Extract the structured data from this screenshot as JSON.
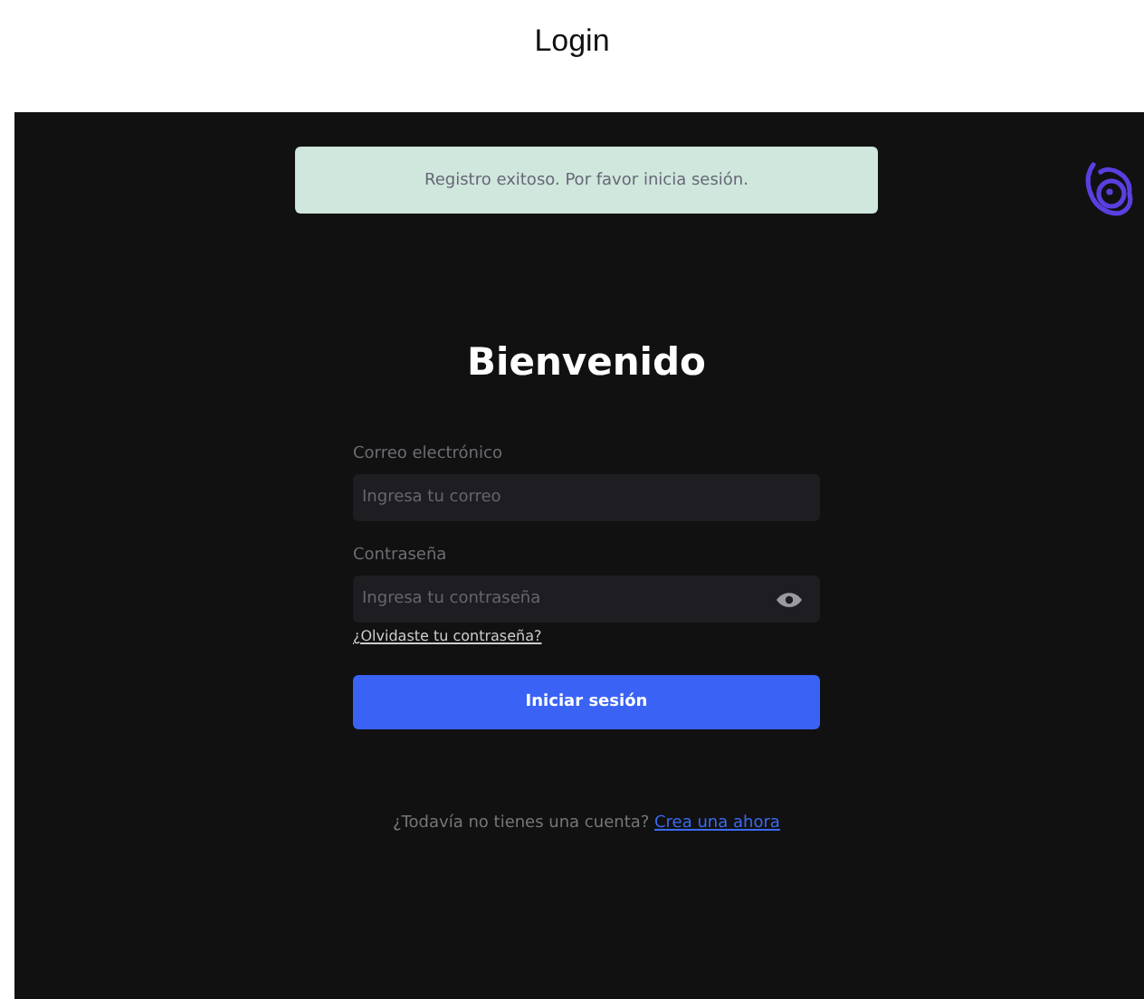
{
  "page_title": "Login",
  "alert": {
    "message": "Registro exitoso. Por favor inicia sesión."
  },
  "heading": "Bienvenido",
  "fields": [
    {
      "label": "Correo electrónico",
      "placeholder": "Ingresa tu correo",
      "kind": "text"
    },
    {
      "label": "Contraseña",
      "placeholder": "Ingresa tu contraseña",
      "kind": "password"
    }
  ],
  "forgot_link": "¿Olvidaste tu contraseña?",
  "submit_button": "Iniciar sesión",
  "signup": {
    "text": "¿Todavía no tienes una cuenta?",
    "link": "Crea una ahora"
  }
}
